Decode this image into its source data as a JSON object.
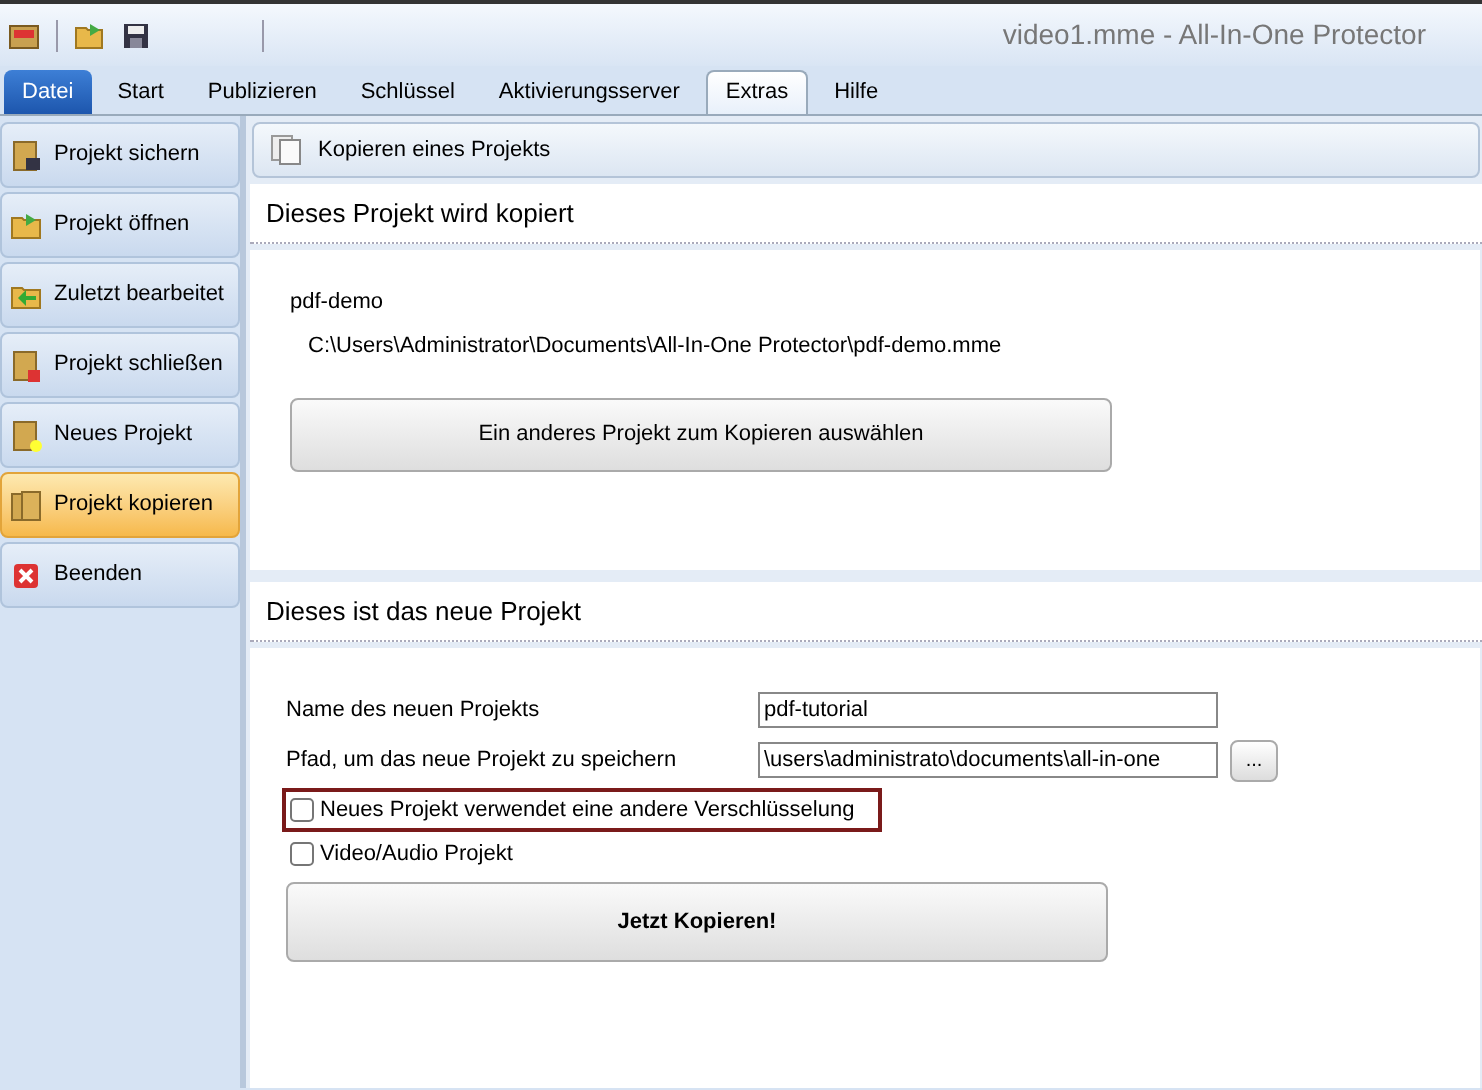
{
  "window": {
    "title": "video1.mme - All-In-One Protector"
  },
  "ribbon_tabs": [
    {
      "label": "Datei",
      "selected": false,
      "kind": "file"
    },
    {
      "label": "Start",
      "selected": false,
      "kind": "tab"
    },
    {
      "label": "Publizieren",
      "selected": false,
      "kind": "tab"
    },
    {
      "label": "Schlüssel",
      "selected": false,
      "kind": "tab"
    },
    {
      "label": "Aktivierungsserver",
      "selected": false,
      "kind": "tab"
    },
    {
      "label": "Extras",
      "selected": true,
      "kind": "tab"
    },
    {
      "label": "Hilfe",
      "selected": false,
      "kind": "tab"
    }
  ],
  "sidebar": {
    "items": [
      {
        "label": "Projekt sichern",
        "selected": false,
        "kind": "save"
      },
      {
        "label": "Projekt öffnen",
        "selected": false,
        "kind": "open"
      },
      {
        "label": "Zuletzt bearbeitet",
        "selected": false,
        "kind": "recent"
      },
      {
        "label": "Projekt schließen",
        "selected": false,
        "kind": "close"
      },
      {
        "label": "Neues Projekt",
        "selected": false,
        "kind": "new"
      },
      {
        "label": "Projekt kopieren",
        "selected": true,
        "kind": "copy"
      },
      {
        "label": "Beenden",
        "selected": false,
        "kind": "exit"
      }
    ]
  },
  "panel": {
    "title": "Kopieren eines Projekts"
  },
  "source_section": {
    "title": "Dieses Projekt wird kopiert",
    "project_name": "pdf-demo",
    "project_path": "C:\\Users\\Administrator\\Documents\\All-In-One Protector\\pdf-demo.mme",
    "button": "Ein anderes Projekt zum Kopieren auswählen"
  },
  "target_section": {
    "title": "Dieses ist das neue Projekt",
    "fields": [
      {
        "label": "Name des neuen Projekts",
        "value": "pdf-tutorial",
        "browse": false
      },
      {
        "label": "Pfad, um das neue Projekt zu speichern",
        "value": "\\users\\administrato\\documents\\all-in-one",
        "browse": true,
        "browse_label": "..."
      }
    ],
    "checkboxes": [
      {
        "label": "Neues Projekt verwendet eine andere Verschlüsselung",
        "checked": false,
        "highlighted": true
      },
      {
        "label": "Video/Audio Projekt",
        "checked": false,
        "highlighted": false
      }
    ],
    "button": "Jetzt Kopieren!"
  }
}
